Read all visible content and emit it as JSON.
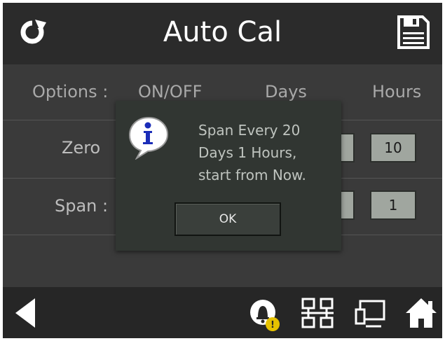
{
  "header": {
    "title": "Auto Cal",
    "left_icon": "refresh-icon",
    "right_icon": "save-icon"
  },
  "table": {
    "options_label": "Options :",
    "onoff_label": "ON/OFF",
    "days_label": "Days",
    "hours_label": "Hours",
    "rows": [
      {
        "label": "Zero",
        "hours_value": "10"
      },
      {
        "label": "Span :",
        "hours_value": "1"
      }
    ]
  },
  "dialog": {
    "icon": "info-icon",
    "message_lines": [
      "Span Every 20",
      "Days 1 Hours,",
      "start from Now."
    ],
    "ok_label": "OK"
  },
  "footer": {
    "icons": [
      "back-arrow-icon",
      "alarm-bell-icon",
      "network-icon",
      "computer-icon",
      "home-icon"
    ],
    "alarm_badge": "!"
  },
  "colors": {
    "header_bg": "#2b2b2b",
    "screen_bg": "#3a3a3a",
    "footer_bg": "#262626",
    "value_box": "#a0a69f",
    "dialog_bg": "#313632",
    "badge": "#e6c200"
  }
}
